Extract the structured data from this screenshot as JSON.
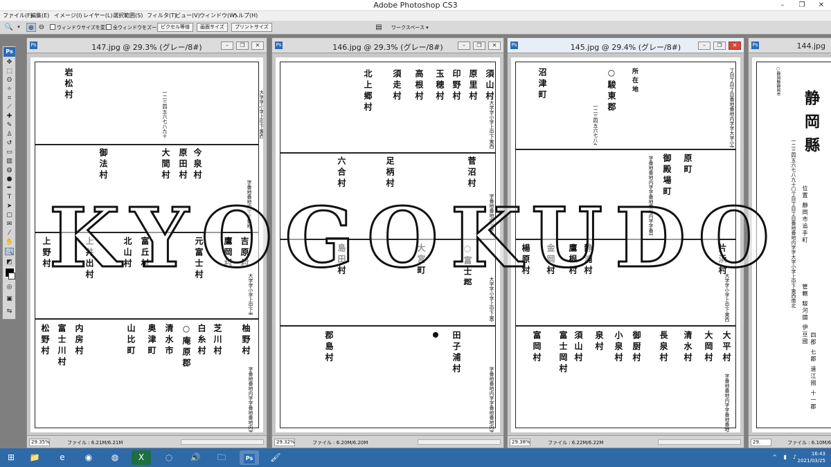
{
  "app": {
    "title": "Adobe Photoshop CS3",
    "window_controls": [
      "–",
      "❐",
      "✕"
    ]
  },
  "menu": [
    "ファイル(F)",
    "編集(E)",
    "イメージ(I)",
    "レイヤー(L)",
    "選択範囲(S)",
    "フィルタ(T)",
    "ビュー(V)",
    "ウィンドウ(W)",
    "ヘルプ(H)"
  ],
  "options_bar": {
    "checkbox_resize": "ウィンドウサイズを変更",
    "checkbox_all_windows": "全ウィンドウをズーム",
    "btn_actual_pixels": "ピクセル等倍",
    "btn_fit_screen": "画面サイズ",
    "btn_print_size": "プリントサイズ",
    "workspace": "ワークスペース ▾"
  },
  "watermark": "KYOGOKUDO",
  "documents": [
    {
      "title": "147.jpg @ 29.3% (グレー/8#)",
      "zoom": "29.35%",
      "file_info": "ファイル : 6.21M/6.21M",
      "names_top": [
        "岩",
        "松",
        "村"
      ],
      "names_row2": [
        "御",
        "法",
        "村",
        "大",
        "間",
        "村",
        "原",
        "田",
        "村",
        "今",
        "泉",
        "村"
      ],
      "names_row3": [
        "上",
        "野",
        "村",
        "上",
        "井",
        "出",
        "村",
        "北",
        "山",
        "村",
        "富",
        "丘",
        "村",
        "元",
        "富",
        "士",
        "村",
        "吉",
        "原",
        "村",
        "鷹",
        "岡",
        "村"
      ],
      "names_row4": [
        "松",
        "野",
        "村",
        "富",
        "士",
        "川",
        "村",
        "内",
        "房",
        "村",
        "芝",
        "川",
        "村",
        "白",
        "糸",
        "村",
        "柚",
        "野",
        "村",
        "山",
        "比",
        "町"
      ],
      "labels": [
        "○庵",
        "原",
        "郡",
        "奥",
        "津",
        "町",
        "清",
        "水",
        "市"
      ]
    },
    {
      "title": "146.jpg @ 29.3% (グレー/8#)",
      "zoom": "29.32%",
      "file_info": "ファイル : 6.20M/6.20M",
      "names_top": [
        "北",
        "上",
        "郷",
        "村",
        "須",
        "走",
        "村",
        "高",
        "根",
        "村",
        "玉",
        "穂",
        "村",
        "印",
        "野",
        "村",
        "原",
        "里",
        "村",
        "須",
        "山",
        "村"
      ],
      "names_row2": [
        "六",
        "合",
        "村",
        "足",
        "柄",
        "村",
        "菅",
        "沼",
        "村"
      ],
      "names_row3": [
        "島",
        "田",
        "村",
        "大",
        "宮",
        "町",
        "○富",
        "士",
        "郡"
      ],
      "names_row4": [
        "郡",
        "島",
        "村",
        "田",
        "子",
        "浦",
        "村"
      ]
    },
    {
      "title": "145.jpg @ 29.4% (グレー/8#)",
      "zoom": "29.38%",
      "file_info": "ファイル : 6.22M/6.22M",
      "names_top": [
        "沼",
        "津",
        "町",
        "○駿",
        "東",
        "郡",
        "所",
        "在",
        "地"
      ],
      "names_row2": [
        "御",
        "殿",
        "場",
        "町",
        "原",
        "町"
      ],
      "names_row3": [
        "楊",
        "原",
        "村",
        "金",
        "岡",
        "村",
        "鷹",
        "根",
        "村",
        "静",
        "浦",
        "村",
        "片",
        "浜",
        "村"
      ],
      "names_row4": [
        "富",
        "岡",
        "村",
        "富",
        "士",
        "岡",
        "村",
        "須",
        "山",
        "村",
        "泉",
        "村",
        "小",
        "泉",
        "村",
        "御",
        "厨",
        "村",
        "長",
        "泉",
        "村",
        "清",
        "水",
        "村",
        "大",
        "岡",
        "村",
        "大",
        "平",
        "村"
      ]
    },
    {
      "title": "144.jpg",
      "zoom": "29.",
      "file_info": "ファイル : 6.10M/6.10M",
      "heading": [
        "静",
        "岡",
        "縣"
      ],
      "prefecture_header": "○靜岡縣靜岡市",
      "location": "位置 靜岡市追手町",
      "jurisdiction": "管轄 駿河國 伊豆國",
      "counties": "四郡 七郡 遠江國 十一郡"
    }
  ],
  "taskbar": {
    "time": "16:43",
    "date": "2021/03/25",
    "apps": [
      "start",
      "explorer",
      "edge-legacy",
      "chrome",
      "firefox",
      "excel",
      "edge",
      "volume",
      "folder",
      "photoshop",
      "paint"
    ]
  }
}
